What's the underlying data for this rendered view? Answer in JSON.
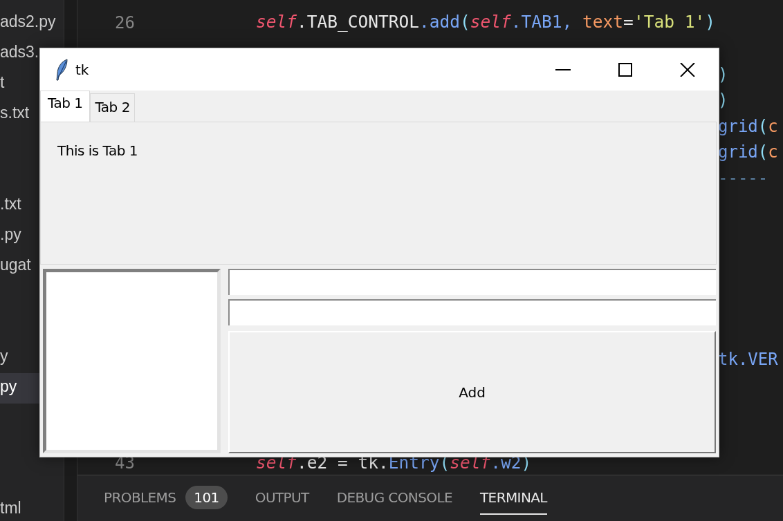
{
  "explorer": {
    "items": [
      {
        "kind": "file",
        "text": "ads2.py",
        "selected": false
      },
      {
        "kind": "file",
        "text": "ads3.",
        "selected": false
      },
      {
        "kind": "file",
        "text": "t",
        "selected": false
      },
      {
        "kind": "file",
        "text": "s.txt",
        "selected": false
      },
      {
        "kind": "gap",
        "selected": false
      },
      {
        "kind": "gap",
        "selected": false
      },
      {
        "kind": "file",
        "text": ".txt",
        "selected": false
      },
      {
        "kind": "file",
        "text": ".py",
        "selected": false
      },
      {
        "kind": "file",
        "text": "ugat",
        "selected": false
      },
      {
        "kind": "gap",
        "selected": false
      },
      {
        "kind": "gap",
        "selected": false
      },
      {
        "kind": "file",
        "text": "y",
        "selected": false
      },
      {
        "kind": "file",
        "text": "py",
        "selected": true
      },
      {
        "kind": "gap",
        "selected": false
      },
      {
        "kind": "gap",
        "selected": false
      },
      {
        "kind": "gap",
        "selected": false
      },
      {
        "kind": "file",
        "text": "tml",
        "selected": false
      }
    ]
  },
  "editor": {
    "lines": [
      {
        "kind": "full",
        "number": "26",
        "tokens": [
          {
            "t": "self",
            "kind": "self"
          },
          {
            "t": ".TAB_CONTROL",
            "kind": "plain"
          },
          {
            "t": ".add",
            "kind": "func"
          },
          {
            "t": "(",
            "kind": "paren"
          },
          {
            "t": "self",
            "kind": "self"
          },
          {
            "t": ".TAB1, ",
            "kind": "func"
          },
          {
            "t": "text",
            "kind": "param"
          },
          {
            "t": "=",
            "kind": "plain"
          },
          {
            "t": "'Tab 1'",
            "kind": "str"
          },
          {
            "t": ")",
            "kind": "paren"
          }
        ]
      },
      {
        "kind": "empty"
      },
      {
        "kind": "tail",
        "tokens": [
          {
            "t": ")",
            "kind": "paren"
          }
        ]
      },
      {
        "kind": "tail",
        "tokens": [
          {
            "t": ")",
            "kind": "paren"
          }
        ]
      },
      {
        "kind": "tail",
        "tokens": [
          {
            "t": "grid",
            "kind": "func"
          },
          {
            "t": "(",
            "kind": "paren"
          },
          {
            "t": "c",
            "kind": "param"
          }
        ]
      },
      {
        "kind": "tail",
        "tokens": [
          {
            "t": "grid",
            "kind": "func"
          },
          {
            "t": "(",
            "kind": "paren"
          },
          {
            "t": "c",
            "kind": "param"
          }
        ]
      },
      {
        "kind": "tail",
        "tokens": [
          {
            "t": "-----",
            "kind": "comment"
          }
        ]
      },
      {
        "kind": "empty"
      },
      {
        "kind": "empty"
      },
      {
        "kind": "empty"
      },
      {
        "kind": "empty"
      },
      {
        "kind": "empty"
      },
      {
        "kind": "empty"
      },
      {
        "kind": "tail",
        "tokens": [
          {
            "t": "tk.VER",
            "kind": "func"
          }
        ]
      },
      {
        "kind": "empty"
      },
      {
        "kind": "empty"
      },
      {
        "kind": "empty"
      },
      {
        "kind": "full",
        "number": "43",
        "tokens": [
          {
            "t": "self",
            "kind": "self"
          },
          {
            "t": ".e2 = tk.",
            "kind": "plain"
          },
          {
            "t": "Entry",
            "kind": "func"
          },
          {
            "t": "(",
            "kind": "paren"
          },
          {
            "t": "self",
            "kind": "self"
          },
          {
            "t": ".w2",
            "kind": "func"
          },
          {
            "t": ")",
            "kind": "paren"
          }
        ]
      }
    ]
  },
  "panel_tabs": [
    {
      "label": "PROBLEMS",
      "badge": "101",
      "selected": false
    },
    {
      "label": "OUTPUT",
      "selected": false
    },
    {
      "label": "DEBUG CONSOLE",
      "selected": false
    },
    {
      "label": "TERMINAL",
      "selected": true
    }
  ],
  "tk_window": {
    "title": "tk",
    "tabs": [
      {
        "label": "Tab 1",
        "selected": true
      },
      {
        "label": "Tab 2",
        "selected": false
      }
    ],
    "tab_content": {
      "label": "This is Tab 1"
    },
    "button": {
      "label": "Add"
    }
  }
}
